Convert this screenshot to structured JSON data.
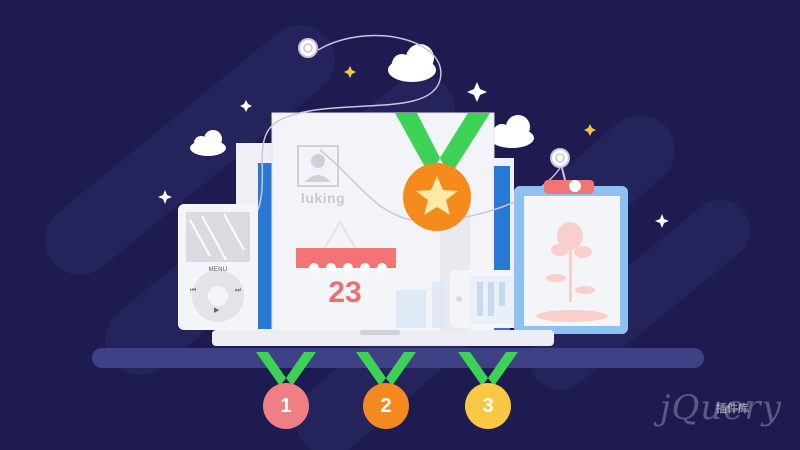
{
  "scene": {
    "profile_name": "luking",
    "calendar_day": "23",
    "ipod": {
      "menu_label": "MENU",
      "prev_glyph": "⏮",
      "next_glyph": "⏭",
      "play_glyph": "▶"
    },
    "medals": [
      {
        "number": "1"
      },
      {
        "number": "2"
      },
      {
        "number": "3"
      }
    ],
    "watermark": {
      "brand": "jQuery",
      "sub": "插件库"
    }
  },
  "colors": {
    "background": "#1d1b4f",
    "shelf": "#3e4185",
    "ribbon": "#3dd155",
    "medal_gold": "#f58a1d",
    "medal_red": "#f07f83",
    "medal_orange": "#f48a1f",
    "medal_yellow": "#f8c843",
    "screen_blue": "#2a78d6",
    "calendar_red": "#f27474"
  },
  "icons": [
    "cloud-icon",
    "sparkle-icon",
    "star-icon",
    "user-avatar-icon",
    "pin-icon",
    "rose-icon"
  ]
}
